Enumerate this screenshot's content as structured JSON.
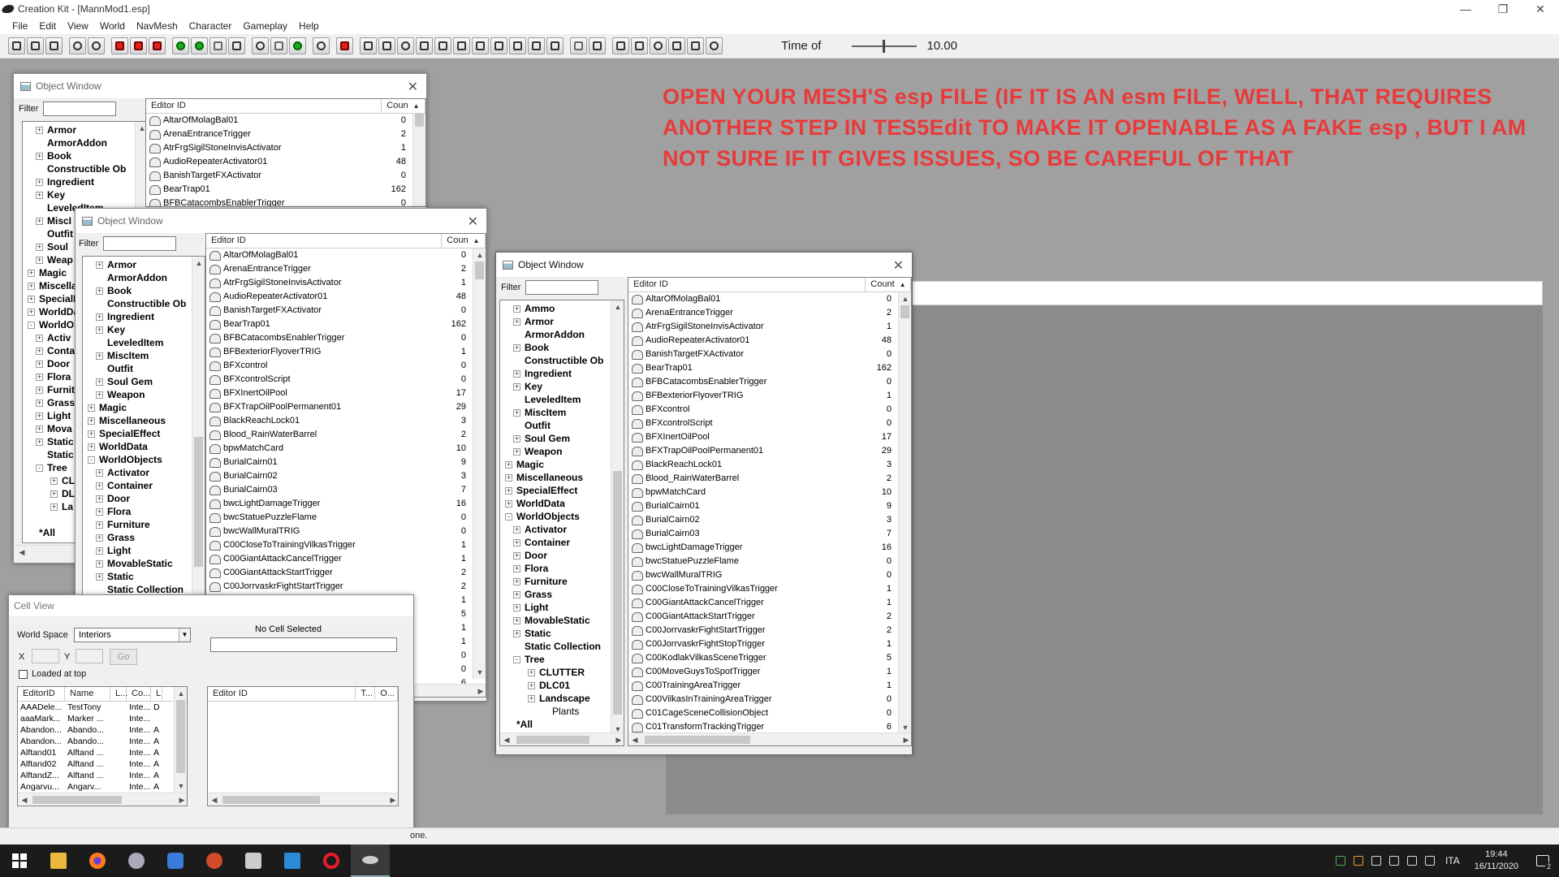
{
  "app": {
    "title": "Creation Kit - [MannMod1.esp]"
  },
  "menu": [
    "File",
    "Edit",
    "View",
    "World",
    "NavMesh",
    "Character",
    "Gameplay",
    "Help"
  ],
  "toolbar": {
    "time_label": "Time of",
    "time_value": "10.00"
  },
  "note": {
    "text": "OPEN YOUR MESH'S esp FILE (IF IT IS AN esm FILE, WELL, THAT REQUIRES ANOTHER STEP IN TES5Edit TO MAKE IT OPENABLE AS A FAKE esp , BUT I AM NOT SURE IF IT GIVES ISSUES, SO BE CAREFUL OF THAT"
  },
  "object_window": {
    "title": "Object Window",
    "filter_label": "Filter",
    "col_editor_id": "Editor ID",
    "col_count": "Count",
    "col_count_short": "Coun"
  },
  "win1": {
    "tree": [
      {
        "label": "Armor",
        "lvl": 1,
        "pm": "+"
      },
      {
        "label": "ArmorAddon",
        "lvl": 1,
        "pm": ""
      },
      {
        "label": "Book",
        "lvl": 1,
        "pm": "+"
      },
      {
        "label": "Constructible Ob",
        "lvl": 1,
        "pm": ""
      },
      {
        "label": "Ingredient",
        "lvl": 1,
        "pm": "+"
      },
      {
        "label": "Key",
        "lvl": 1,
        "pm": "+"
      },
      {
        "label": "LeveledItem",
        "lvl": 1,
        "pm": ""
      },
      {
        "label": "MiscI",
        "lvl": 1,
        "pm": "+"
      },
      {
        "label": "Outfit",
        "lvl": 1,
        "pm": ""
      },
      {
        "label": "Soul",
        "lvl": 1,
        "pm": "+"
      },
      {
        "label": "Weap",
        "lvl": 1,
        "pm": "+"
      },
      {
        "label": "Magic",
        "lvl": 0,
        "pm": "+"
      },
      {
        "label": "Miscellar",
        "lvl": 0,
        "pm": "+"
      },
      {
        "label": "SpecialE",
        "lvl": 0,
        "pm": "+"
      },
      {
        "label": "WorldDat",
        "lvl": 0,
        "pm": "+"
      },
      {
        "label": "WorldObj",
        "lvl": 0,
        "pm": "-"
      },
      {
        "label": "Activ",
        "lvl": 1,
        "pm": "+"
      },
      {
        "label": "Conta",
        "lvl": 1,
        "pm": "+"
      },
      {
        "label": "Door",
        "lvl": 1,
        "pm": "+"
      },
      {
        "label": "Flora",
        "lvl": 1,
        "pm": "+"
      },
      {
        "label": "Furnit",
        "lvl": 1,
        "pm": "+"
      },
      {
        "label": "Grass",
        "lvl": 1,
        "pm": "+"
      },
      {
        "label": "Light",
        "lvl": 1,
        "pm": "+"
      },
      {
        "label": "Mova",
        "lvl": 1,
        "pm": "+"
      },
      {
        "label": "Static",
        "lvl": 1,
        "pm": "+"
      },
      {
        "label": "Static",
        "lvl": 1,
        "pm": ""
      },
      {
        "label": "Tree",
        "lvl": 1,
        "pm": "-"
      },
      {
        "label": "CL",
        "lvl": 2,
        "pm": "+"
      },
      {
        "label": "DL",
        "lvl": 2,
        "pm": "+"
      },
      {
        "label": "La",
        "lvl": 2,
        "pm": "+"
      },
      {
        "label": "Pla",
        "lvl": 3,
        "pm": ""
      },
      {
        "label": "*All",
        "lvl": 0,
        "pm": ""
      }
    ],
    "rows": [
      [
        "AltarOfMolagBal01",
        "0"
      ],
      [
        "ArenaEntranceTrigger",
        "2"
      ],
      [
        "AtrFrgSigilStoneInvisActivator",
        "1"
      ],
      [
        "AudioRepeaterActivator01",
        "48"
      ],
      [
        "BanishTargetFXActivator",
        "0"
      ],
      [
        "BearTrap01",
        "162"
      ],
      [
        "BFBCatacombsEnablerTrigger",
        "0"
      ]
    ]
  },
  "win2": {
    "tree": [
      {
        "label": "Armor",
        "lvl": 1,
        "pm": "+"
      },
      {
        "label": "ArmorAddon",
        "lvl": 1,
        "pm": ""
      },
      {
        "label": "Book",
        "lvl": 1,
        "pm": "+"
      },
      {
        "label": "Constructible Ob",
        "lvl": 1,
        "pm": ""
      },
      {
        "label": "Ingredient",
        "lvl": 1,
        "pm": "+"
      },
      {
        "label": "Key",
        "lvl": 1,
        "pm": "+"
      },
      {
        "label": "LeveledItem",
        "lvl": 1,
        "pm": ""
      },
      {
        "label": "MiscItem",
        "lvl": 1,
        "pm": "+"
      },
      {
        "label": "Outfit",
        "lvl": 1,
        "pm": ""
      },
      {
        "label": "Soul Gem",
        "lvl": 1,
        "pm": "+"
      },
      {
        "label": "Weapon",
        "lvl": 1,
        "pm": "+"
      },
      {
        "label": "Magic",
        "lvl": 0,
        "pm": "+"
      },
      {
        "label": "Miscellaneous",
        "lvl": 0,
        "pm": "+"
      },
      {
        "label": "SpecialEffect",
        "lvl": 0,
        "pm": "+"
      },
      {
        "label": "WorldData",
        "lvl": 0,
        "pm": "+"
      },
      {
        "label": "WorldObjects",
        "lvl": 0,
        "pm": "-"
      },
      {
        "label": "Activator",
        "lvl": 1,
        "pm": "+"
      },
      {
        "label": "Container",
        "lvl": 1,
        "pm": "+"
      },
      {
        "label": "Door",
        "lvl": 1,
        "pm": "+"
      },
      {
        "label": "Flora",
        "lvl": 1,
        "pm": "+"
      },
      {
        "label": "Furniture",
        "lvl": 1,
        "pm": "+"
      },
      {
        "label": "Grass",
        "lvl": 1,
        "pm": "+"
      },
      {
        "label": "Light",
        "lvl": 1,
        "pm": "+"
      },
      {
        "label": "MovableStatic",
        "lvl": 1,
        "pm": "+"
      },
      {
        "label": "Static",
        "lvl": 1,
        "pm": "+"
      },
      {
        "label": "Static Collection",
        "lvl": 1,
        "pm": ""
      }
    ],
    "rows": [
      [
        "AltarOfMolagBal01",
        "0"
      ],
      [
        "ArenaEntranceTrigger",
        "2"
      ],
      [
        "AtrFrgSigilStoneInvisActivator",
        "1"
      ],
      [
        "AudioRepeaterActivator01",
        "48"
      ],
      [
        "BanishTargetFXActivator",
        "0"
      ],
      [
        "BearTrap01",
        "162"
      ],
      [
        "BFBCatacombsEnablerTrigger",
        "0"
      ],
      [
        "BFBexteriorFlyoverTRIG",
        "1"
      ],
      [
        "BFXcontrol",
        "0"
      ],
      [
        "BFXcontrolScript",
        "0"
      ],
      [
        "BFXInertOilPool",
        "17"
      ],
      [
        "BFXTrapOilPoolPermanent01",
        "29"
      ],
      [
        "BlackReachLock01",
        "3"
      ],
      [
        "Blood_RainWaterBarrel",
        "2"
      ],
      [
        "bpwMatchCard",
        "10"
      ],
      [
        "BurialCairn01",
        "9"
      ],
      [
        "BurialCairn02",
        "3"
      ],
      [
        "BurialCairn03",
        "7"
      ],
      [
        "bwcLightDamageTrigger",
        "16"
      ],
      [
        "bwcStatuePuzzleFlame",
        "0"
      ],
      [
        "bwcWallMuralTRIG",
        "0"
      ],
      [
        "C00CloseToTrainingVilkasTrigger",
        "1"
      ],
      [
        "C00GiantAttackCancelTrigger",
        "1"
      ],
      [
        "C00GiantAttackStartTrigger",
        "2"
      ],
      [
        "C00JorrvaskrFightStartTrigger",
        "2"
      ],
      [
        "",
        "1"
      ],
      [
        "",
        "5"
      ],
      [
        "",
        "1"
      ],
      [
        "",
        "1"
      ],
      [
        "",
        "0"
      ],
      [
        "",
        "0"
      ],
      [
        "",
        "6"
      ]
    ]
  },
  "win3": {
    "tree": [
      {
        "label": "Ammo",
        "lvl": 1,
        "pm": "+"
      },
      {
        "label": "Armor",
        "lvl": 1,
        "pm": "+"
      },
      {
        "label": "ArmorAddon",
        "lvl": 1,
        "pm": ""
      },
      {
        "label": "Book",
        "lvl": 1,
        "pm": "+"
      },
      {
        "label": "Constructible Ob",
        "lvl": 1,
        "pm": ""
      },
      {
        "label": "Ingredient",
        "lvl": 1,
        "pm": "+"
      },
      {
        "label": "Key",
        "lvl": 1,
        "pm": "+"
      },
      {
        "label": "LeveledItem",
        "lvl": 1,
        "pm": ""
      },
      {
        "label": "MiscItem",
        "lvl": 1,
        "pm": "+"
      },
      {
        "label": "Outfit",
        "lvl": 1,
        "pm": ""
      },
      {
        "label": "Soul Gem",
        "lvl": 1,
        "pm": "+"
      },
      {
        "label": "Weapon",
        "lvl": 1,
        "pm": "+"
      },
      {
        "label": "Magic",
        "lvl": 0,
        "pm": "+"
      },
      {
        "label": "Miscellaneous",
        "lvl": 0,
        "pm": "+"
      },
      {
        "label": "SpecialEffect",
        "lvl": 0,
        "pm": "+"
      },
      {
        "label": "WorldData",
        "lvl": 0,
        "pm": "+"
      },
      {
        "label": "WorldObjects",
        "lvl": 0,
        "pm": "-"
      },
      {
        "label": "Activator",
        "lvl": 1,
        "pm": "+"
      },
      {
        "label": "Container",
        "lvl": 1,
        "pm": "+"
      },
      {
        "label": "Door",
        "lvl": 1,
        "pm": "+"
      },
      {
        "label": "Flora",
        "lvl": 1,
        "pm": "+"
      },
      {
        "label": "Furniture",
        "lvl": 1,
        "pm": "+"
      },
      {
        "label": "Grass",
        "lvl": 1,
        "pm": "+"
      },
      {
        "label": "Light",
        "lvl": 1,
        "pm": "+"
      },
      {
        "label": "MovableStatic",
        "lvl": 1,
        "pm": "+"
      },
      {
        "label": "Static",
        "lvl": 1,
        "pm": "+"
      },
      {
        "label": "Static Collection",
        "lvl": 1,
        "pm": ""
      },
      {
        "label": "Tree",
        "lvl": 1,
        "pm": "-"
      },
      {
        "label": "CLUTTER",
        "lvl": 2,
        "pm": "+"
      },
      {
        "label": "DLC01",
        "lvl": 2,
        "pm": "+"
      },
      {
        "label": "Landscape",
        "lvl": 2,
        "pm": "+"
      },
      {
        "label": "Plants",
        "lvl": 3,
        "pm": ""
      },
      {
        "label": "*All",
        "lvl": 0,
        "pm": ""
      }
    ],
    "rows": [
      [
        "AltarOfMolagBal01",
        "0"
      ],
      [
        "ArenaEntranceTrigger",
        "2"
      ],
      [
        "AtrFrgSigilStoneInvisActivator",
        "1"
      ],
      [
        "AudioRepeaterActivator01",
        "48"
      ],
      [
        "BanishTargetFXActivator",
        "0"
      ],
      [
        "BearTrap01",
        "162"
      ],
      [
        "BFBCatacombsEnablerTrigger",
        "0"
      ],
      [
        "BFBexteriorFlyoverTRIG",
        "1"
      ],
      [
        "BFXcontrol",
        "0"
      ],
      [
        "BFXcontrolScript",
        "0"
      ],
      [
        "BFXInertOilPool",
        "17"
      ],
      [
        "BFXTrapOilPoolPermanent01",
        "29"
      ],
      [
        "BlackReachLock01",
        "3"
      ],
      [
        "Blood_RainWaterBarrel",
        "2"
      ],
      [
        "bpwMatchCard",
        "10"
      ],
      [
        "BurialCairn01",
        "9"
      ],
      [
        "BurialCairn02",
        "3"
      ],
      [
        "BurialCairn03",
        "7"
      ],
      [
        "bwcLightDamageTrigger",
        "16"
      ],
      [
        "bwcStatuePuzzleFlame",
        "0"
      ],
      [
        "bwcWallMuralTRIG",
        "0"
      ],
      [
        "C00CloseToTrainingVilkasTrigger",
        "1"
      ],
      [
        "C00GiantAttackCancelTrigger",
        "1"
      ],
      [
        "C00GiantAttackStartTrigger",
        "2"
      ],
      [
        "C00JorrvaskrFightStartTrigger",
        "2"
      ],
      [
        "C00JorrvaskrFightStopTrigger",
        "1"
      ],
      [
        "C00KodlakVilkasSceneTrigger",
        "5"
      ],
      [
        "C00MoveGuysToSpotTrigger",
        "1"
      ],
      [
        "C00TrainingAreaTrigger",
        "1"
      ],
      [
        "C00VilkasInTrainingAreaTrigger",
        "0"
      ],
      [
        "C01CageSceneCollisionObject",
        "0"
      ],
      [
        "C01TransformTrackingTrigger",
        "6"
      ]
    ]
  },
  "cell_view": {
    "title": "Cell View",
    "world_space_label": "World Space",
    "world_space_value": "Interiors",
    "x_label": "X",
    "y_label": "Y",
    "go_label": "Go",
    "loaded_at_top": "Loaded at top",
    "no_cell": "No Cell Selected",
    "left_cols": [
      "EditorID",
      "Name",
      "L...",
      "Co...",
      "L"
    ],
    "left_rows": [
      [
        "AAADele...",
        "TestTony",
        "",
        "Inte...",
        "D"
      ],
      [
        "aaaMark...",
        "Marker ...",
        "",
        "Inte...",
        ""
      ],
      [
        "Abandon...",
        "Abando...",
        "",
        "Inte...",
        "A"
      ],
      [
        "Abandon...",
        "Abando...",
        "",
        "Inte...",
        "A"
      ],
      [
        "Alftand01",
        "Alftand ...",
        "",
        "Inte...",
        "A"
      ],
      [
        "Alftand02",
        "Alftand ...",
        "",
        "Inte...",
        "A"
      ],
      [
        "AlftandZ...",
        "Alftand ...",
        "",
        "Inte...",
        "A"
      ],
      [
        "Angarvu...",
        "Angarv...",
        "",
        "Inte...",
        "A"
      ]
    ],
    "right_cols": [
      "Editor ID",
      "T...",
      "O..."
    ]
  },
  "status": {
    "text": "one."
  },
  "taskbar": {
    "lang": "ITA",
    "time": "19:44",
    "date": "16/11/2020",
    "notif_count": "2"
  }
}
